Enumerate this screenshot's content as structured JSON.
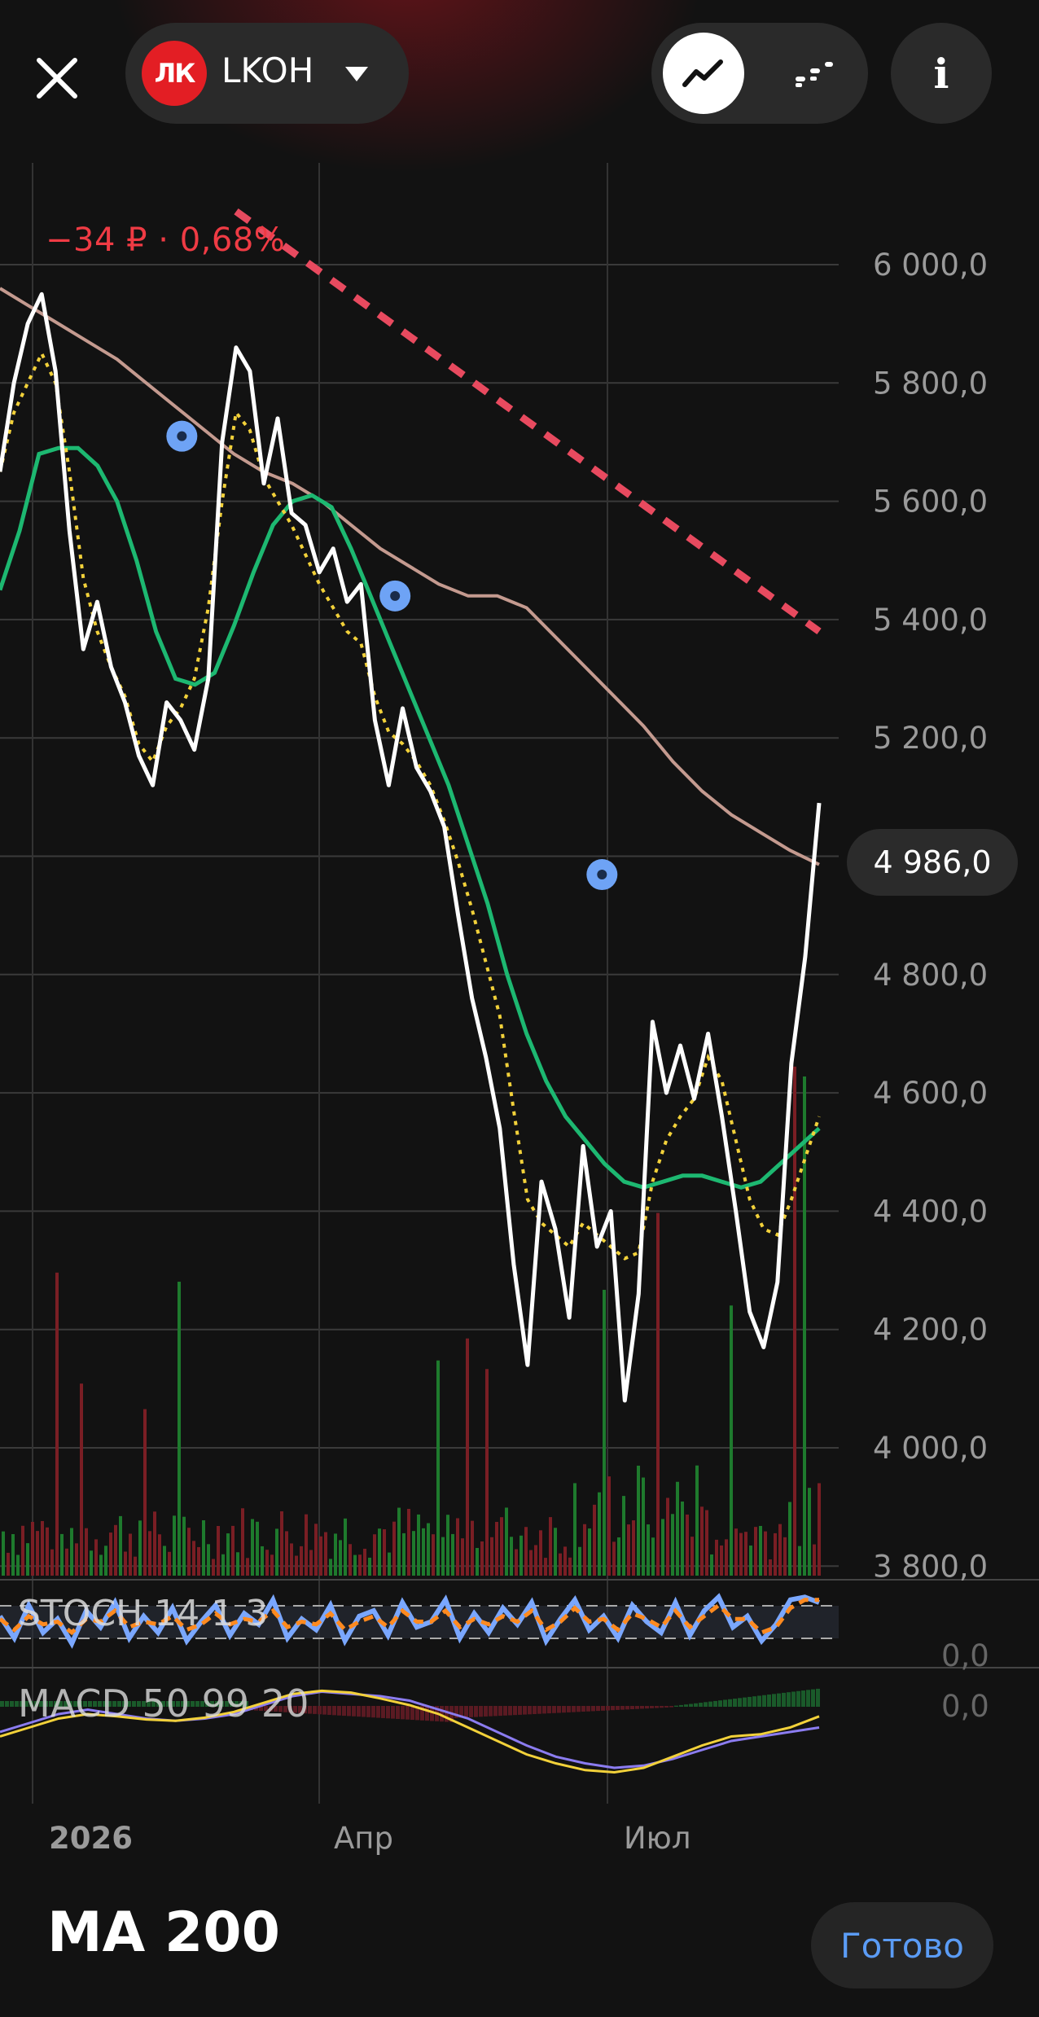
{
  "header": {
    "ticker": "LKOH",
    "logo_text": "ЛК",
    "change_text": "−34 ₽ · 0,68%",
    "info_label": "i",
    "icons": {
      "close": "close-icon",
      "caret": "chevron-down-icon",
      "line_mode": "line-chart-icon",
      "candle_mode": "candle-chart-icon",
      "info": "info-icon"
    }
  },
  "price_axis": {
    "ticks": [
      "6 000,0",
      "5 800,0",
      "5 600,0",
      "5 400,0",
      "5 200,0",
      "4 800,0",
      "4 600,0",
      "4 400,0",
      "4 200,0",
      "4 000,0",
      "3 800,0"
    ],
    "current_price": "4 986,0"
  },
  "time_axis": {
    "labels": [
      "2026",
      "Апр",
      "Июл"
    ]
  },
  "indicators": {
    "stoch": {
      "label": "STOCH 14 1 3",
      "axis": "0,0"
    },
    "macd": {
      "label": "MACD 50 99 20",
      "axis": "0,0"
    }
  },
  "footer": {
    "title": "MA 200",
    "done_label": "Готово"
  },
  "colors": {
    "price": "#ffffff",
    "ma_long": "#c49a8f",
    "ma_mid": "#1db871",
    "ma_short": "#f2d13a",
    "trend": "#e84a5f",
    "marker": "#6ea3f5",
    "vol_up": "#1e7a2d",
    "vol_down": "#7a1e24",
    "stoch_k": "#7aa7ff",
    "stoch_d": "#ff8a1f",
    "macd_line": "#8b7cf0",
    "macd_signal": "#f2d13a",
    "negative": "#ef3b44",
    "accent": "#5b9cf5"
  },
  "chart_data": {
    "type": "line",
    "ylim": [
      3800,
      6100
    ],
    "x": [
      0,
      3,
      6,
      9,
      12,
      15,
      18,
      21,
      24,
      27,
      30,
      33,
      36,
      39,
      42,
      45,
      48,
      51,
      54,
      57,
      60,
      63,
      66,
      69,
      72,
      75,
      78,
      81,
      84,
      87,
      90,
      93,
      96,
      99,
      102,
      105,
      108,
      111,
      114,
      117,
      120,
      123,
      126,
      129,
      132,
      135,
      138,
      141,
      144,
      147,
      150,
      153,
      156,
      159,
      162,
      165,
      168,
      171,
      174,
      177,
      180,
      183,
      186,
      189,
      192,
      195,
      198,
      201,
      204,
      207,
      210,
      213,
      216,
      219,
      222,
      225,
      228,
      231,
      234,
      237,
      240,
      243,
      246,
      249,
      252,
      255,
      258,
      261
    ],
    "series": [
      {
        "key": "price",
        "values": [
          5650,
          5800,
          5900,
          5950,
          5820,
          5550,
          5350,
          5430,
          5320,
          5260,
          5170,
          5120,
          5260,
          5230,
          5180,
          5300,
          5700,
          5860,
          5820,
          5630,
          5740,
          5580,
          5560,
          5480,
          5520,
          5430,
          5460,
          5230,
          5120,
          5250,
          5150,
          5110,
          5050,
          4900,
          4760,
          4660,
          4540,
          4310,
          4140,
          4450,
          4370,
          4220,
          4510,
          4340,
          4400,
          4080,
          4260,
          4720,
          4600,
          4680,
          4590,
          4700,
          4560,
          4400,
          4230,
          4170,
          4280,
          4650,
          4830,
          5090
        ]
      },
      {
        "key": "ma_short",
        "values": [
          5650,
          5750,
          5800,
          5850,
          5800,
          5650,
          5470,
          5380,
          5320,
          5270,
          5190,
          5160,
          5220,
          5250,
          5300,
          5420,
          5600,
          5750,
          5720,
          5640,
          5600,
          5560,
          5510,
          5460,
          5420,
          5380,
          5360,
          5270,
          5210,
          5190,
          5160,
          5120,
          5060,
          4990,
          4910,
          4820,
          4730,
          4570,
          4420,
          4380,
          4360,
          4340,
          4380,
          4360,
          4340,
          4320,
          4330,
          4450,
          4520,
          4560,
          4590,
          4660,
          4620,
          4520,
          4420,
          4370,
          4360,
          4420,
          4490,
          4560
        ]
      },
      {
        "key": "ma_mid",
        "values": [
          5450,
          5550,
          5680,
          5690,
          5690,
          5660,
          5600,
          5500,
          5380,
          5300,
          5290,
          5310,
          5390,
          5480,
          5560,
          5600,
          5610,
          5590,
          5520,
          5440,
          5360,
          5280,
          5200,
          5120,
          5020,
          4920,
          4800,
          4700,
          4620,
          4560,
          4520,
          4480,
          4450,
          4440,
          4450,
          4460,
          4460,
          4450,
          4440,
          4450,
          4480,
          4510,
          4540
        ]
      },
      {
        "key": "ma_long",
        "values": [
          5960,
          5930,
          5900,
          5870,
          5840,
          5800,
          5760,
          5720,
          5680,
          5650,
          5630,
          5600,
          5560,
          5520,
          5490,
          5460,
          5440,
          5440,
          5420,
          5370,
          5320,
          5270,
          5220,
          5160,
          5110,
          5070,
          5040,
          5010,
          4986
        ]
      },
      {
        "key": "trend",
        "values": [
          6090,
          5380
        ]
      }
    ],
    "markers": [
      5710,
      5440,
      4969
    ],
    "marker_x": [
      58,
      126,
      192
    ],
    "stoch": {
      "k": [
        60,
        20,
        80,
        30,
        55,
        10,
        70,
        40,
        85,
        20,
        60,
        30,
        75,
        15,
        50,
        80,
        25,
        65,
        45,
        90,
        20,
        55,
        35,
        80,
        15,
        60,
        70,
        25,
        85,
        40,
        50,
        90,
        20,
        65,
        30,
        75,
        45,
        85,
        15,
        55,
        90,
        35,
        60,
        20,
        80,
        50,
        30,
        85,
        25,
        70,
        95,
        40,
        60,
        15,
        45,
        90,
        95,
        85
      ],
      "d": [
        55,
        35,
        60,
        45,
        50,
        30,
        55,
        50,
        70,
        40,
        50,
        45,
        60,
        35,
        45,
        65,
        45,
        55,
        50,
        70,
        40,
        50,
        45,
        65,
        35,
        50,
        60,
        40,
        70,
        50,
        50,
        70,
        40,
        55,
        45,
        60,
        50,
        70,
        35,
        50,
        75,
        50,
        55,
        35,
        65,
        55,
        40,
        70,
        40,
        60,
        80,
        55,
        55,
        30,
        40,
        75,
        90,
        90
      ]
    },
    "macd": {
      "line": [
        -40,
        -20,
        0,
        10,
        0,
        -10,
        -15,
        -10,
        0,
        20,
        40,
        50,
        45,
        40,
        30,
        10,
        -10,
        -40,
        -70,
        -95,
        -110,
        -120,
        -115,
        -100,
        -80,
        -60,
        -50,
        -40,
        -30
      ],
      "signal": [
        -50,
        -30,
        -10,
        0,
        -5,
        -12,
        -15,
        -8,
        5,
        25,
        45,
        52,
        48,
        35,
        20,
        0,
        -30,
        -60,
        -90,
        -110,
        -125,
        -130,
        -120,
        -95,
        -70,
        -50,
        -45,
        -30,
        -5
      ]
    },
    "volume_up_color": "#1e7a2d",
    "volume_down_color": "#7a1e24"
  }
}
